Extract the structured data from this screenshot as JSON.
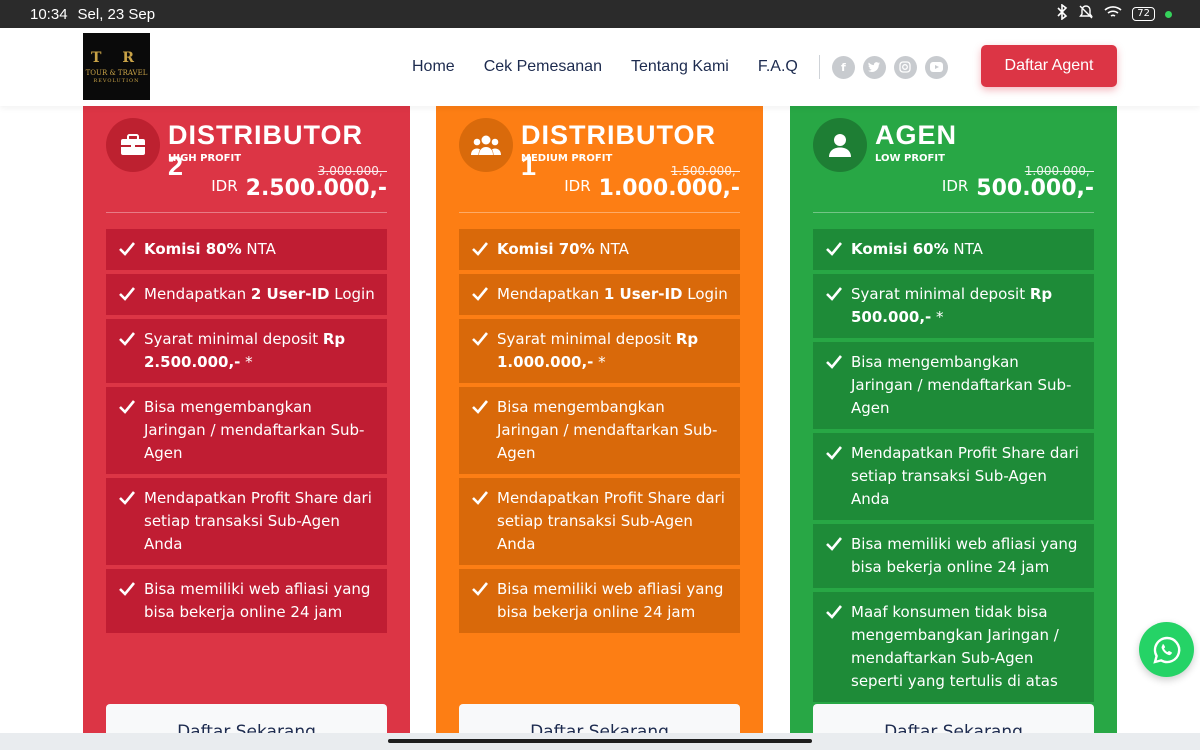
{
  "status_bar": {
    "time": "10:34",
    "date": "Sel, 23 Sep",
    "battery": "72"
  },
  "brand": {
    "logo_mark": "T R",
    "logo_line1": "TOUR & TRAVEL",
    "logo_line2": "REVOLUTION"
  },
  "nav": {
    "items": [
      "Home",
      "Cek Pemesanan",
      "Tentang Kami",
      "F.A.Q"
    ],
    "social_icons": [
      "facebook-icon",
      "twitter-icon",
      "instagram-icon",
      "youtube-icon"
    ],
    "cta_label": "Daftar Agent"
  },
  "colors": {
    "red": "#dc3545",
    "orange": "#fd7e14",
    "green": "#28a745",
    "whatsapp": "#25d366"
  },
  "plans": [
    {
      "name": "DISTRIBUTOR 2",
      "tag": "HIGH PROFIT",
      "icon": "briefcase-icon",
      "old_price": "3.000.000,-",
      "currency": "IDR",
      "price": "2.500.000,-",
      "features": [
        [
          {
            "t": "Komisi 80%",
            "b": true
          },
          {
            "t": " NTA",
            "b": false
          }
        ],
        [
          {
            "t": "Mendapatkan ",
            "b": false
          },
          {
            "t": "2 User-ID",
            "b": true
          },
          {
            "t": " Login",
            "b": false
          }
        ],
        [
          {
            "t": "Syarat minimal deposit ",
            "b": false
          },
          {
            "t": "Rp 2.500.000,-",
            "b": true
          },
          {
            "t": " *",
            "b": false
          }
        ],
        [
          {
            "t": "Bisa mengembangkan Jaringan / mendaftarkan Sub-Agen",
            "b": false
          }
        ],
        [
          {
            "t": "Mendapatkan Profit Share dari setiap transaksi Sub-Agen Anda",
            "b": false
          }
        ],
        [
          {
            "t": "Bisa memiliki web afliasi yang bisa bekerja online 24 jam",
            "b": false
          }
        ]
      ],
      "button": "Daftar Sekarang"
    },
    {
      "name": "DISTRIBUTOR 1",
      "tag": "MEDIUM PROFIT",
      "icon": "users-icon",
      "old_price": "1.500.000,-",
      "currency": "IDR",
      "price": "1.000.000,-",
      "features": [
        [
          {
            "t": "Komisi 70%",
            "b": true
          },
          {
            "t": " NTA",
            "b": false
          }
        ],
        [
          {
            "t": "Mendapatkan ",
            "b": false
          },
          {
            "t": "1 User-ID",
            "b": true
          },
          {
            "t": " Login",
            "b": false
          }
        ],
        [
          {
            "t": "Syarat minimal deposit ",
            "b": false
          },
          {
            "t": "Rp 1.000.000,-",
            "b": true
          },
          {
            "t": " *",
            "b": false
          }
        ],
        [
          {
            "t": "Bisa mengembangkan Jaringan / mendaftarkan Sub-Agen",
            "b": false
          }
        ],
        [
          {
            "t": "Mendapatkan Profit Share dari setiap transaksi Sub-Agen Anda",
            "b": false
          }
        ],
        [
          {
            "t": "Bisa memiliki web afliasi yang bisa bekerja online 24 jam",
            "b": false
          }
        ]
      ],
      "button": "Daftar Sekarang"
    },
    {
      "name": "AGEN",
      "tag": "LOW PROFIT",
      "icon": "user-icon",
      "old_price": "1.000.000,-",
      "currency": "IDR",
      "price": "500.000,-",
      "features": [
        [
          {
            "t": "Komisi 60%",
            "b": true
          },
          {
            "t": " NTA",
            "b": false
          }
        ],
        [
          {
            "t": "Syarat minimal deposit ",
            "b": false
          },
          {
            "t": "Rp 500.000,-",
            "b": true
          },
          {
            "t": " *",
            "b": false
          }
        ],
        [
          {
            "t": "Bisa mengembangkan Jaringan / mendaftarkan Sub-Agen",
            "b": false
          }
        ],
        [
          {
            "t": "Mendapatkan Profit Share dari setiap transaksi Sub-Agen Anda",
            "b": false
          }
        ],
        [
          {
            "t": "Bisa memiliki web afliasi yang bisa bekerja online 24 jam",
            "b": false
          }
        ],
        [
          {
            "t": "Maaf konsumen tidak bisa mengembangkan Jaringan / mendaftarkan Sub-Agen seperti yang tertulis di atas",
            "b": false
          }
        ]
      ],
      "button": "Daftar Sekarang"
    }
  ]
}
